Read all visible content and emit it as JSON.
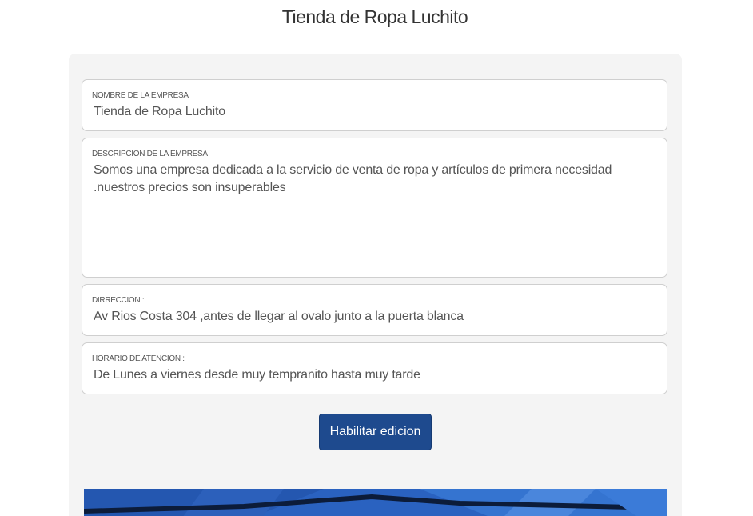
{
  "header": {
    "title": "Tienda de Ropa Luchito"
  },
  "form": {
    "company_name": {
      "label": "NOMBRE DE LA EMPRESA",
      "value": "Tienda de Ropa Luchito"
    },
    "company_description": {
      "label": "DESCRIPCION DE LA EMPRESA",
      "value": "Somos una empresa dedicada a la servicio de venta de ropa y artículos de primera necesidad .nuestros precios son insuperables"
    },
    "address": {
      "label": "DIRRECCION :",
      "value": "Av Rios Costa 304 ,antes de llegar al ovalo junto a la puerta blanca"
    },
    "hours": {
      "label": "HORARIO DE ATENCION :",
      "value": "De Lunes a viernes desde muy tempranito hasta muy tarde"
    },
    "enable_edit_label": "Habilitar edicion"
  },
  "colors": {
    "button": "#1e4a8e",
    "panel": "#f4f4f4",
    "banner": "#2a62c0"
  }
}
